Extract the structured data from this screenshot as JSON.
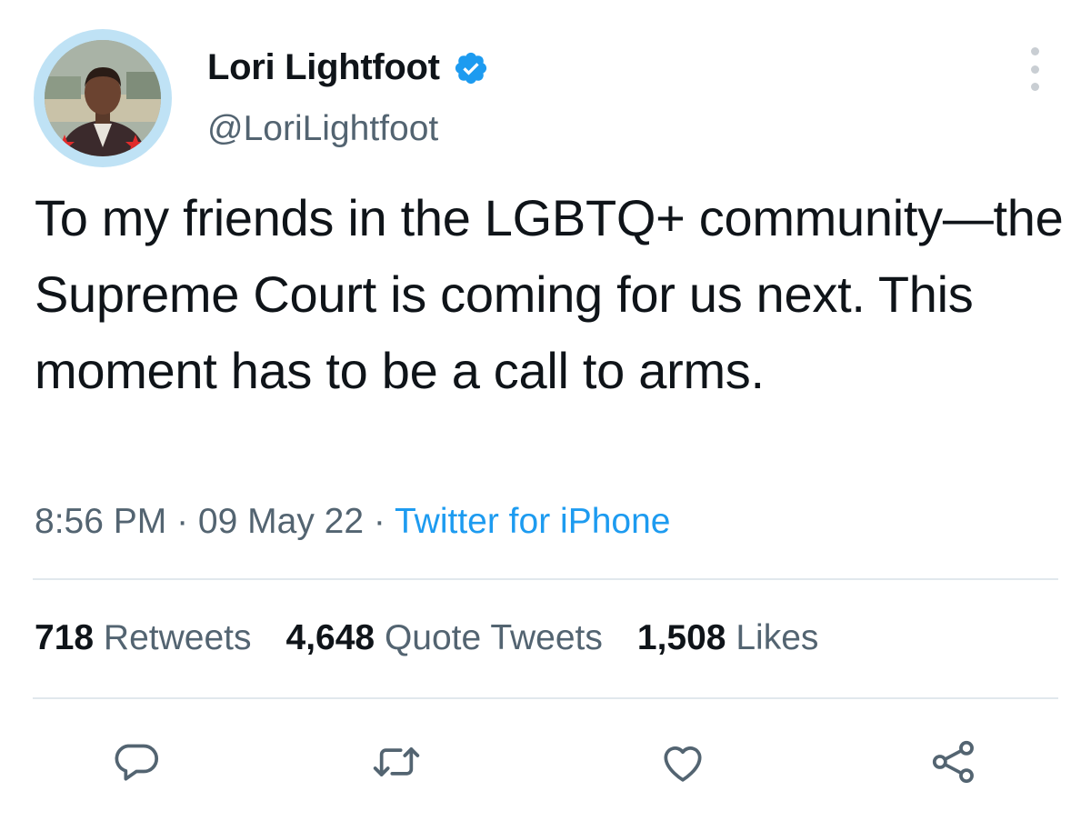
{
  "user": {
    "display_name": "Lori Lightfoot",
    "handle": "@LoriLightfoot",
    "verified": true,
    "avatar_icon": "profile-photo"
  },
  "tweet": {
    "text": "To my friends in the LGBTQ+ community—the Supreme Court is coming for us next. This moment has to be a call to arms.",
    "time": "8:56 PM",
    "separator": " · ",
    "date": "09 May 22",
    "source": "Twitter for iPhone"
  },
  "stats": {
    "retweets_count": "718",
    "retweets_label": "Retweets",
    "quotes_count": "4,648",
    "quotes_label": "Quote Tweets",
    "likes_count": "1,508",
    "likes_label": "Likes"
  },
  "actions": {
    "reply": "reply-icon",
    "retweet": "retweet-icon",
    "like": "heart-icon",
    "share": "share-icon"
  },
  "colors": {
    "text": "#0f1419",
    "secondary": "#536471",
    "link": "#1d9bf0",
    "verified": "#1d9bf0",
    "divider": "#e1e8ed",
    "avatar_ring": "#bfe2f5"
  }
}
